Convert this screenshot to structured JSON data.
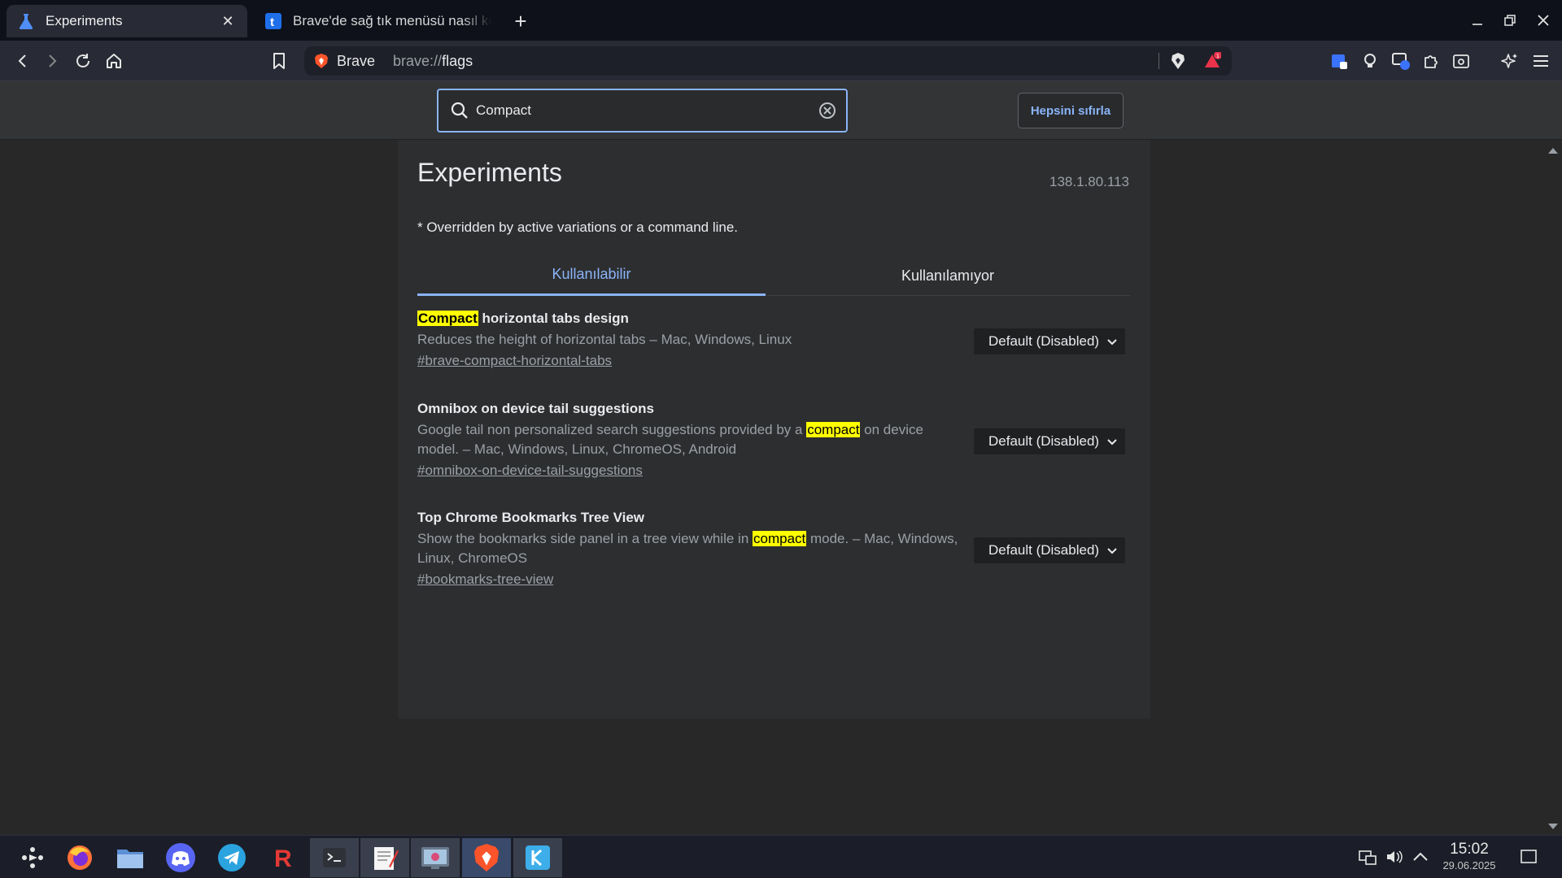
{
  "browser": {
    "tabs": [
      {
        "title": "Experiments",
        "icon": "flask-icon",
        "active": true
      },
      {
        "title": "Brave'de sağ tık menüsü nasıl kü",
        "icon": "tumblr-t-icon",
        "active": false
      }
    ],
    "omnibox": {
      "brand": "Brave",
      "url_prefix": "brave://",
      "url_path": "flags"
    },
    "notification_count": "1"
  },
  "search": {
    "value": "Compact",
    "reset_label": "Hepsini sıfırla"
  },
  "page": {
    "title": "Experiments",
    "version": "138.1.80.113",
    "note": "* Overridden by active variations or a command line.",
    "tabs": [
      {
        "label": "Kullanılabilir",
        "selected": true
      },
      {
        "label": "Kullanılamıyor",
        "selected": false
      }
    ]
  },
  "experiments": [
    {
      "name_highlight": "Compact",
      "name_rest": " horizontal tabs design",
      "desc": "Reduces the height of horizontal tabs – Mac, Windows, Linux",
      "link": "#brave-compact-horizontal-tabs",
      "value": "Default (Disabled)"
    },
    {
      "name": "Omnibox on device tail suggestions",
      "desc_before": "Google tail non personalized search suggestions provided by a ",
      "desc_highlight": "compact",
      "desc_after": " on device model. – Mac, Windows, Linux, ChromeOS, Android",
      "link": "#omnibox-on-device-tail-suggestions",
      "value": "Default (Disabled)"
    },
    {
      "name": "Top Chrome Bookmarks Tree View",
      "desc_before": "Show the bookmarks side panel in a tree view while in ",
      "desc_highlight": "compact",
      "desc_after": " mode. – Mac, Windows, Linux, ChromeOS",
      "link": "#bookmarks-tree-view",
      "value": "Default (Disabled)"
    }
  ],
  "taskbar": {
    "apps": [
      "app-launcher-icon",
      "firefox-icon",
      "file-manager-icon",
      "discord-icon",
      "telegram-icon",
      "r-app-icon",
      "terminal-icon",
      "text-editor-icon",
      "screenshot-tool-icon",
      "brave-icon",
      "kde-connect-icon"
    ],
    "time": "15:02",
    "date": "29.06.2025"
  },
  "colors": {
    "accent": "#8ab4f8",
    "highlight": "#ffff00",
    "tabstrip_bg": "#0e111a",
    "toolbar_bg": "#282a35",
    "page_bg": "#2d2e30"
  }
}
